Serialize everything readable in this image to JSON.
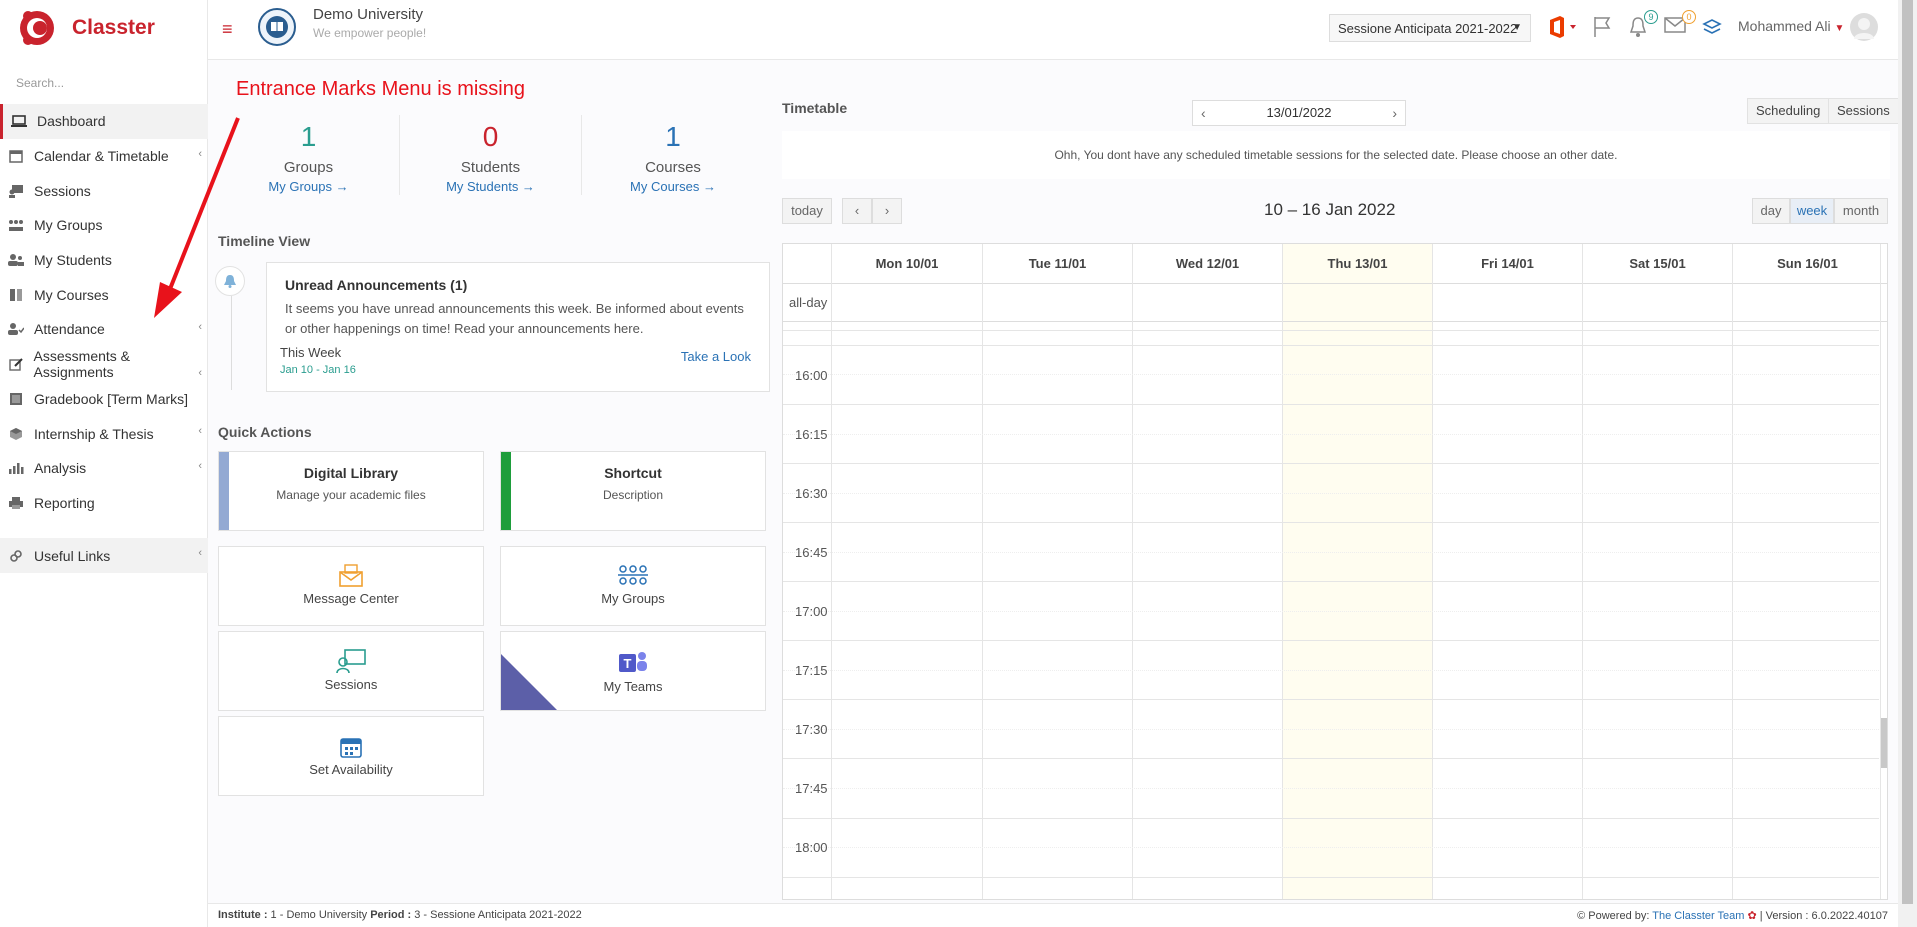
{
  "brand": {
    "name": "Classter",
    "color": "#c9232d"
  },
  "sidebar": {
    "search_placeholder": "Search...",
    "items": [
      {
        "label": "Dashboard",
        "icon": "laptop-icon",
        "active": true,
        "chevron": false
      },
      {
        "label": "Calendar & Timetable",
        "icon": "calendar-icon",
        "chevron": true
      },
      {
        "label": "Sessions",
        "icon": "presentation-icon",
        "chevron": false
      },
      {
        "label": "My Groups",
        "icon": "groups-icon",
        "chevron": false
      },
      {
        "label": "My Students",
        "icon": "students-icon",
        "chevron": false
      },
      {
        "label": "My Courses",
        "icon": "book-icon",
        "chevron": false
      },
      {
        "label": "Attendance",
        "icon": "user-check-icon",
        "chevron": true
      },
      {
        "label": "Assessments & Assignments",
        "icon": "edit-icon",
        "chevron": true
      },
      {
        "label": "Gradebook [Term Marks]",
        "icon": "gradebook-icon",
        "chevron": false
      },
      {
        "label": "Internship & Thesis",
        "icon": "cube-icon",
        "chevron": true
      },
      {
        "label": "Analysis",
        "icon": "bar-chart-icon",
        "chevron": true
      },
      {
        "label": "Reporting",
        "icon": "printer-icon",
        "chevron": false
      }
    ],
    "useful_links": "Useful Links"
  },
  "header": {
    "university": "Demo University",
    "tagline": "We empower people!",
    "session": "Sessione Anticipata 2021-2022",
    "notif_count": "9",
    "mail_count": "0",
    "user": "Mohammed Ali"
  },
  "annotation": "Entrance Marks Menu is missing",
  "stats": [
    {
      "value": "1",
      "label": "Groups",
      "link": "My Groups  →",
      "color": "#2a9d8f"
    },
    {
      "value": "0",
      "label": "Students",
      "link": "My Students  →",
      "color": "#c9232d"
    },
    {
      "value": "1",
      "label": "Courses",
      "link": "My Courses  →",
      "color": "#2a72b5"
    }
  ],
  "timeline": {
    "title": "Timeline View",
    "card_title": "Unread Announcements (1)",
    "card_body": "It seems you have unread announcements this week. Be informed about events or other happenings on time! Read your announcements here.",
    "week": "This Week",
    "dates": "Jan 10 - Jan 16",
    "link": "Take a Look"
  },
  "quick_actions": {
    "title": "Quick Actions",
    "digital_library": {
      "title": "Digital Library",
      "desc": "Manage your academic files"
    },
    "shortcut": {
      "title": "Shortcut",
      "desc": "Description"
    },
    "message_center": "Message Center",
    "my_groups": "My Groups",
    "sessions": "Sessions",
    "my_teams": "My Teams",
    "set_availability": "Set Availability"
  },
  "timetable": {
    "title": "Timetable",
    "date": "13/01/2022",
    "scheduling": "Scheduling",
    "sessions": "Sessions",
    "notice": "Ohh, You dont have any scheduled timetable sessions for the selected date. Please choose an other date."
  },
  "calendar": {
    "today": "today",
    "range": "10 – 16 Jan 2022",
    "views": [
      "day",
      "week",
      "month"
    ],
    "days": [
      "Mon 10/01",
      "Tue 11/01",
      "Wed 12/01",
      "Thu 13/01",
      "Fri 14/01",
      "Sat 15/01",
      "Sun 16/01"
    ],
    "allday": "all-day",
    "times": [
      "16:00",
      "16:15",
      "16:30",
      "16:45",
      "17:00",
      "17:15",
      "17:30",
      "17:45",
      "18:00"
    ]
  },
  "footer": {
    "institute_label": "Institute :",
    "institute": " 1 - Demo University ",
    "period_label": "Period :",
    "period": " 3 - Sessione Anticipata 2021-2022",
    "powered": "Powered by:",
    "team": "The Classter Team",
    "version": "| Version : 6.0.2022.40107"
  }
}
